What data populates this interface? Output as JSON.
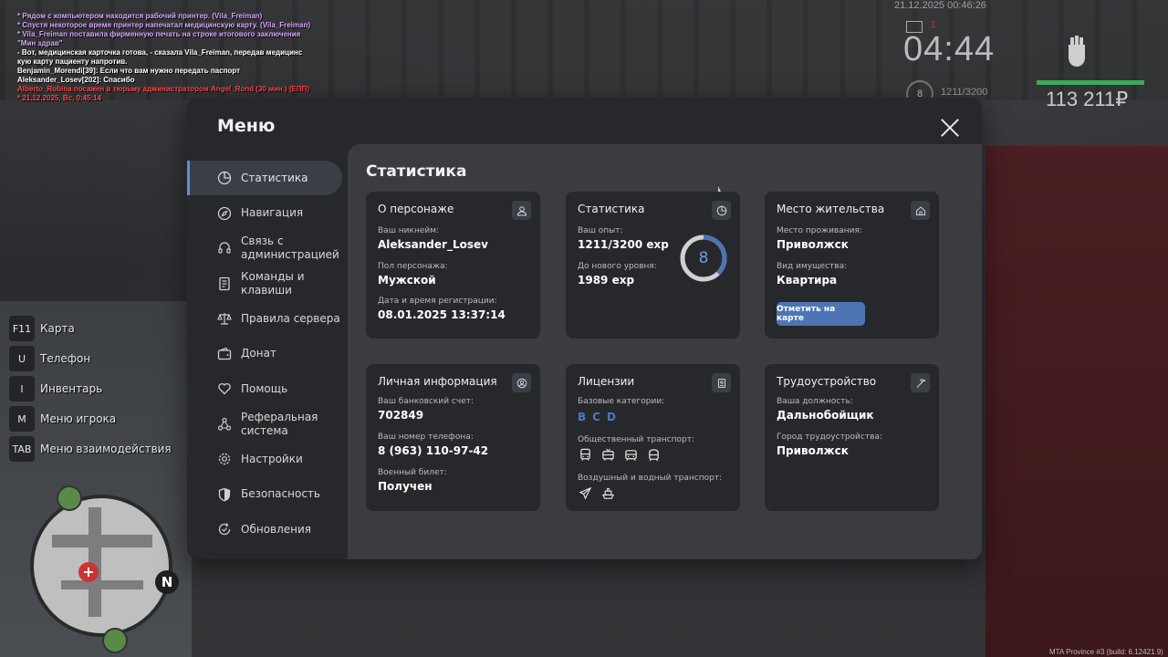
{
  "hud": {
    "date": "21.12.2025 00:46:26",
    "time": "04:44",
    "mail_count": "1",
    "level": "8",
    "exp": "1211/3200",
    "money": "113 211₽",
    "build": "MTA Province #3 (build: 6.12421.9)"
  },
  "chat": [
    {
      "text": "* Рядом с компьютером находится рабочий принтер. (Vila_Freiman)",
      "color": "purple"
    },
    {
      "text": "* Спустя некоторое время принтер напечатал медицинскую карту. (Vila_Freiman)",
      "color": "purple"
    },
    {
      "text": "* Vila_Freiman поставила фирменную печать на строке итогового заключения",
      "color": "purple"
    },
    {
      "text": "\"Мин здрав\"",
      "color": "purple"
    },
    {
      "text": "- Вот, медицинская карточка готова, - сказала Vila_Freiman, передав медицинс",
      "color": "white"
    },
    {
      "text": "кую карту пациенту напротив.",
      "color": "white"
    },
    {
      "text": "Benjamin_Morendi[39]: Если что вам нужно передать паспорт",
      "color": "white"
    },
    {
      "text": "Aleksander_Losev[202]: Спасибо",
      "color": "white"
    },
    {
      "text": "Alberto_Robina посажен в тюрьму администратором Angel_Rond (30 мин.) (ЕПП)",
      "color": "red"
    },
    {
      "text": "* 21.12.2025, Вс, 0:45:14",
      "color": "red"
    }
  ],
  "hotkeys": [
    {
      "key": "F11",
      "label": "Карта"
    },
    {
      "key": "U",
      "label": "Телефон"
    },
    {
      "key": "I",
      "label": "Инвентарь"
    },
    {
      "key": "M",
      "label": "Меню игрока"
    },
    {
      "key": "TAB",
      "label": "Меню взаимодействия"
    }
  ],
  "minimap": {
    "north": "N"
  },
  "menu": {
    "title": "Меню",
    "nav": [
      {
        "label": "Статистика",
        "icon": "pie-chart-icon"
      },
      {
        "label": "Навигация",
        "icon": "compass-icon"
      },
      {
        "label": "Связь с администрацией",
        "icon": "headset-icon"
      },
      {
        "label": "Команды и клавиши",
        "icon": "document-icon"
      },
      {
        "label": "Правила сервера",
        "icon": "scales-icon"
      },
      {
        "label": "Донат",
        "icon": "wallet-icon"
      },
      {
        "label": "Помощь",
        "icon": "heart-hand-icon"
      },
      {
        "label": "Реферальная система",
        "icon": "network-icon"
      },
      {
        "label": "Настройки",
        "icon": "gear-icon"
      },
      {
        "label": "Безопасность",
        "icon": "shield-icon"
      },
      {
        "label": "Обновления",
        "icon": "refresh-icon"
      }
    ]
  },
  "content": {
    "title": "Статистика",
    "character": {
      "title": "О персонаже",
      "nickname_label": "Ваш никнейм:",
      "nickname": "Aleksander_Losev",
      "gender_label": "Пол персонажа:",
      "gender": "Мужской",
      "reg_label": "Дата и время регистрации:",
      "reg": "08.01.2025 13:37:14"
    },
    "stats": {
      "title": "Статистика",
      "exp_label": "Ваш опыт:",
      "exp": "1211/3200 exp",
      "next_label": "До нового уровня:",
      "next": "1989 exp",
      "level": "8",
      "progress": 0.378
    },
    "residence": {
      "title": "Место жительства",
      "place_label": "Место проживания:",
      "place": "Приволжск",
      "property_label": "Вид имущества:",
      "property": "Квартира",
      "button": "Отметить на карте"
    },
    "personal": {
      "title": "Личная информация",
      "bank_label": "Ваш банковский счет:",
      "bank": "702849",
      "phone_label": "Ваш номер телефона:",
      "phone": "8 (963) 110-97-42",
      "military_label": "Военный билет:",
      "military": "Получен"
    },
    "licenses": {
      "title": "Лицензии",
      "base_label": "Базовые категории:",
      "categories": [
        "B",
        "C",
        "D"
      ],
      "public_label": "Общественный транспорт:",
      "public_icons": [
        "bus-icon",
        "trolleybus-icon",
        "tram-icon",
        "train-icon"
      ],
      "air_label": "Воздушный и водный транспорт:",
      "air_icons": [
        "plane-icon",
        "boat-icon"
      ]
    },
    "employment": {
      "title": "Трудоустройство",
      "position_label": "Ваша должность:",
      "position": "Дальнобойщик",
      "city_label": "Город трудоустройства:",
      "city": "Приволжск"
    }
  },
  "colors": {
    "accent": "#4d75b3",
    "panel": "#26282c",
    "content_bg": "#3a3c40",
    "money_bar": "#3ea957"
  }
}
